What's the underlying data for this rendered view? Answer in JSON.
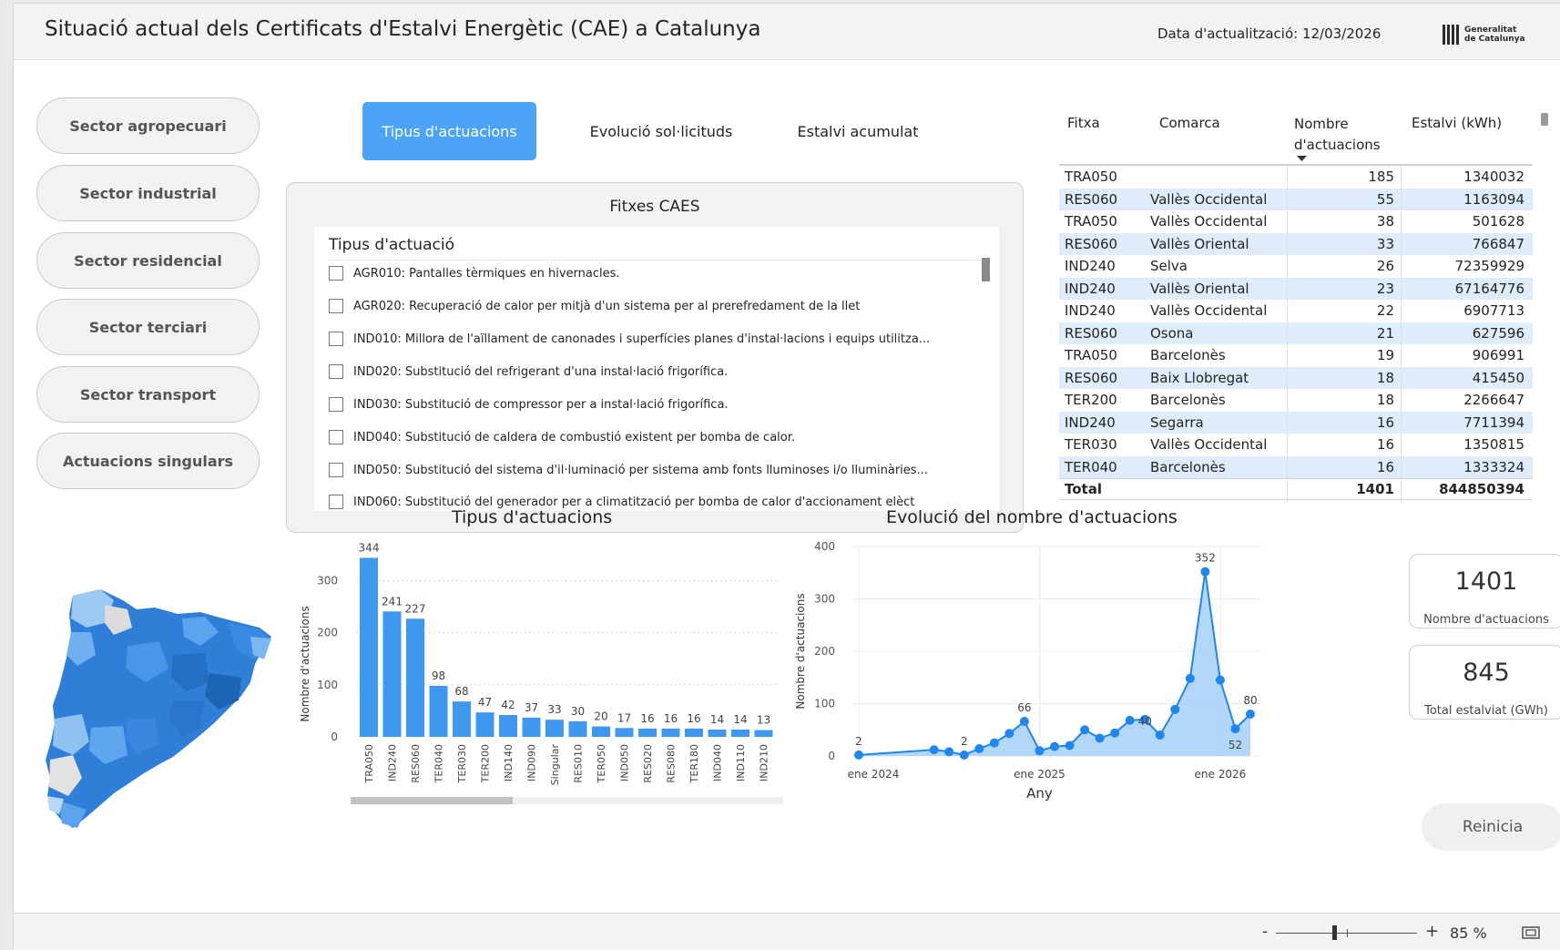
{
  "header": {
    "title": "Situació actual dels Certificats d'Estalvi Energètic (CAE) a Catalunya",
    "date": "Data d'actualització: 12/03/2026",
    "logo_line1": "Generalitat",
    "logo_line2": "de Catalunya"
  },
  "sectors": [
    "Sector agropecuari",
    "Sector industrial",
    "Sector residencial",
    "Sector terciari",
    "Sector transport",
    "Actuacions singulars"
  ],
  "tabs": [
    "Tipus d'actuacions",
    "Evolució sol·licituds",
    "Estalvi acumulat"
  ],
  "caes": {
    "title": "Fitxes CAES",
    "heading": "Tipus d'actuació",
    "items": [
      "AGR010: Pantalles tèrmiques en hivernacles.",
      "AGR020: Recuperació de calor per mitjà d'un sistema per al prerefredament de la llet",
      "IND010: Millora de l'aïllament de canonades i superfícies planes d'instal·lacions i equips utilitza...",
      "IND020: Substitució del refrigerant d'una instal·lació frigorífica.",
      "IND030: Substitució de compressor per a instal·lació frigorífica.",
      "IND040: Substitució de caldera de combustió existent per bomba de calor.",
      "IND050: Substitució del sistema d'il·luminació per sistema amb fonts lluminoses i/o lluminàries...",
      "IND060: Substitució del generador per a climatització per bomba de calor d'accionament elèct"
    ]
  },
  "table": {
    "headers": [
      "Fitxa",
      "Comarca",
      "Nombre d'actuacions",
      "Estalvi (kWh)"
    ],
    "rows": [
      {
        "fitxa": "TRA050",
        "comarca": "",
        "n": "185",
        "kwh": "1340032"
      },
      {
        "fitxa": "RES060",
        "comarca": "Vallès Occidental",
        "n": "55",
        "kwh": "1163094"
      },
      {
        "fitxa": "TRA050",
        "comarca": "Vallès Occidental",
        "n": "38",
        "kwh": "501628"
      },
      {
        "fitxa": "RES060",
        "comarca": "Vallès Oriental",
        "n": "33",
        "kwh": "766847"
      },
      {
        "fitxa": "IND240",
        "comarca": "Selva",
        "n": "26",
        "kwh": "72359929"
      },
      {
        "fitxa": "IND240",
        "comarca": "Vallès Oriental",
        "n": "23",
        "kwh": "67164776"
      },
      {
        "fitxa": "IND240",
        "comarca": "Vallès Occidental",
        "n": "22",
        "kwh": "6907713"
      },
      {
        "fitxa": "RES060",
        "comarca": "Osona",
        "n": "21",
        "kwh": "627596"
      },
      {
        "fitxa": "TRA050",
        "comarca": "Barcelonès",
        "n": "19",
        "kwh": "906991"
      },
      {
        "fitxa": "RES060",
        "comarca": "Baix Llobregat",
        "n": "18",
        "kwh": "415450"
      },
      {
        "fitxa": "TER200",
        "comarca": "Barcelonès",
        "n": "18",
        "kwh": "2266647"
      },
      {
        "fitxa": "IND240",
        "comarca": "Segarra",
        "n": "16",
        "kwh": "7711394"
      },
      {
        "fitxa": "TER030",
        "comarca": "Vallès Occidental",
        "n": "16",
        "kwh": "1350815"
      },
      {
        "fitxa": "TER040",
        "comarca": "Barcelonès",
        "n": "16",
        "kwh": "1333324"
      }
    ],
    "total": {
      "label": "Total",
      "n": "1401",
      "kwh": "844850394"
    }
  },
  "bar_chart": {
    "title": "Tipus d'actuacions",
    "ylabel": "Nombre d'actuacions",
    "bar_color": "#3f98f0"
  },
  "line_chart": {
    "title": "Evolució del nombre d'actuacions",
    "ylabel": "Nombre d'actuacions",
    "xlabel": "Any",
    "x_ticks": [
      "ene 2024",
      "ene 2025",
      "ene 2026"
    ],
    "line_color": "#1f86ee",
    "fill_color": "#9fcdf8"
  },
  "chart_data": [
    {
      "type": "bar",
      "title": "Tipus d'actuacions",
      "ylabel": "Nombre d'actuacions",
      "ylim": [
        0,
        350
      ],
      "yticks": [
        0,
        100,
        200,
        300
      ],
      "categories": [
        "TRA050",
        "IND240",
        "RES060",
        "TER040",
        "TER030",
        "TER200",
        "IND140",
        "IND090",
        "Singular",
        "RES010",
        "TER050",
        "IND050",
        "RES020",
        "RES080",
        "TER180",
        "IND040",
        "IND110",
        "IND210"
      ],
      "values": [
        344,
        241,
        227,
        98,
        68,
        47,
        42,
        37,
        33,
        30,
        20,
        17,
        16,
        16,
        16,
        14,
        14,
        13
      ]
    },
    {
      "type": "area",
      "title": "Evolució del nombre d'actuacions",
      "xlabel": "Any",
      "ylabel": "Nombre d'actuacions",
      "ylim": [
        0,
        400
      ],
      "yticks": [
        0,
        100,
        200,
        300,
        400
      ],
      "x": [
        "2024-01",
        "2024-06",
        "2024-07",
        "2024-08",
        "2024-09",
        "2024-10",
        "2024-11",
        "2024-12",
        "2025-01",
        "2025-02",
        "2025-03",
        "2025-04",
        "2025-05",
        "2025-06",
        "2025-07",
        "2025-08",
        "2025-09",
        "2025-10",
        "2025-11",
        "2025-12",
        "2026-01",
        "2026-02",
        "2026-03"
      ],
      "values": [
        2,
        12,
        8,
        2,
        14,
        25,
        43,
        66,
        10,
        18,
        20,
        50,
        34,
        44,
        68,
        70,
        40,
        89,
        148,
        352,
        145,
        52,
        80
      ],
      "data_labels": {
        "2024-01": 2,
        "2024-08": 2,
        "2024-12": 66,
        "2025-08": 40,
        "2025-12": 352,
        "2026-02": 52,
        "2026-03": 80
      }
    }
  ],
  "kpis": [
    {
      "value": "1401",
      "label": "Nombre d'actuacions"
    },
    {
      "value": "845",
      "label": "Total estalviat (GWh)"
    }
  ],
  "reset_label": "Reinicia",
  "footer": {
    "zoom_minus": "-",
    "zoom_plus": "+",
    "zoom": "85 %"
  }
}
